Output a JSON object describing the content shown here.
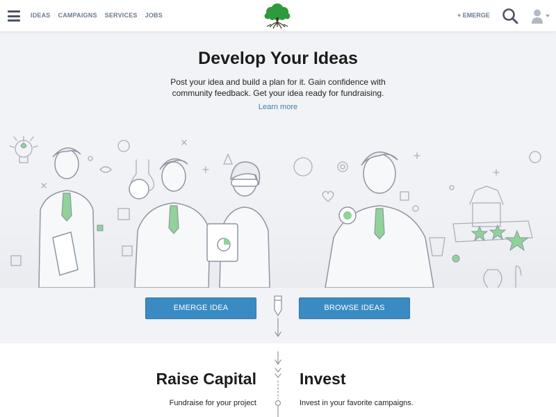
{
  "nav": {
    "items": [
      "IDEAS",
      "CAMPAIGNS",
      "SERVICES",
      "JOBS"
    ],
    "emerge_label": "EMERGE",
    "emerge_icon": "plus-icon"
  },
  "icons": {
    "menu": "hamburger-menu-icon",
    "logo": "tree-logo",
    "search": "search-icon",
    "user": "user-avatar-icon"
  },
  "hero": {
    "title": "Develop Your Ideas",
    "description": "Post your idea and build a plan for it. Gain confidence with community feedback. Get your idea ready for fundraising.",
    "learn_more": "Learn more",
    "emerge_button": "EMERGE IDEA",
    "browse_button": "BROWSE IDEAS"
  },
  "raise": {
    "title": "Raise Capital",
    "text": "Fundraise for your project"
  },
  "invest": {
    "title": "Invest",
    "text": "Invest in your favorite campaigns."
  },
  "colors": {
    "accent": "#3a8bc4",
    "link": "#3a7fb0",
    "hero_bg": "#f2f3f6",
    "logo_green": "#2e9a3c",
    "nav_text": "#6b7a8f"
  }
}
